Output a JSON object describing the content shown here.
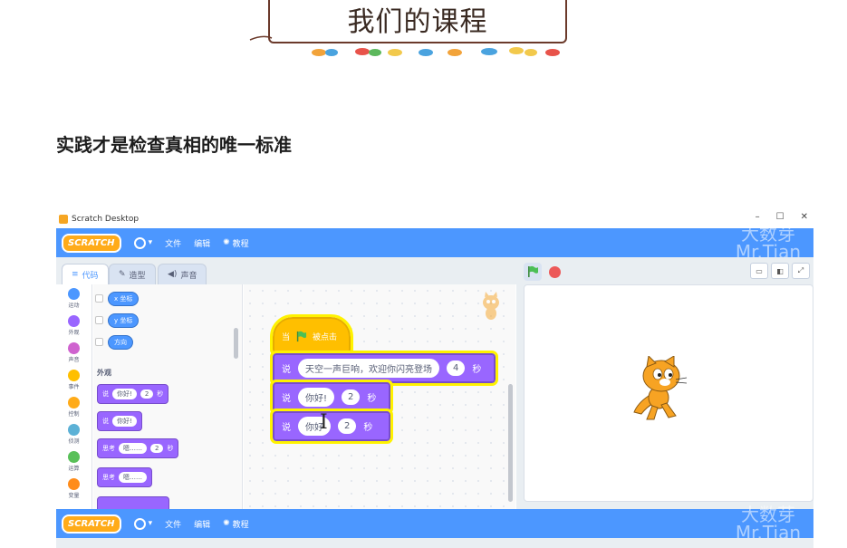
{
  "banner": {
    "title": "我们的课程"
  },
  "section": {
    "heading": "实践才是检查真相的唯一标准"
  },
  "window": {
    "title": "Scratch Desktop",
    "controls": [
      "–",
      "☐",
      "✕"
    ]
  },
  "menubar": {
    "logo": "SCRATCH",
    "file": "文件",
    "edit": "编辑",
    "tutorials": "教程",
    "watermark_line1": "大数芽",
    "watermark_line2": "Mr.Tian"
  },
  "tabs": {
    "code": "代码",
    "costumes": "造型",
    "sounds": "声音"
  },
  "categories": [
    {
      "label": "运动",
      "color": "#4c97ff"
    },
    {
      "label": "外观",
      "color": "#9966ff"
    },
    {
      "label": "声音",
      "color": "#cf63cf"
    },
    {
      "label": "事件",
      "color": "#ffbf00"
    },
    {
      "label": "控制",
      "color": "#ffab19"
    },
    {
      "label": "侦测",
      "color": "#5cb1d6"
    },
    {
      "label": "运算",
      "color": "#59c059"
    },
    {
      "label": "变量",
      "color": "#ff8c1a"
    }
  ],
  "palette": {
    "reporters": [
      "x 坐标",
      "y 坐标",
      "方向"
    ],
    "looks_heading": "外观",
    "blocks": [
      {
        "verb": "说",
        "input": "你好!",
        "num": "2",
        "unit": "秒"
      },
      {
        "verb": "说",
        "input": "你好!",
        "num": "",
        "unit": ""
      },
      {
        "verb": "思考",
        "input": "嗯……",
        "num": "2",
        "unit": "秒"
      },
      {
        "verb": "思考",
        "input": "嗯……",
        "num": "",
        "unit": ""
      }
    ]
  },
  "script": {
    "hat_when": "当",
    "hat_clicked": "被点击",
    "say_blocks": [
      {
        "verb": "说",
        "text": "天空一声巨响，欢迎你闪亮登场",
        "num": "4",
        "unit": "秒"
      },
      {
        "verb": "说",
        "text": "你好!",
        "num": "2",
        "unit": "秒"
      },
      {
        "verb": "说",
        "text": "你好",
        "num": "2",
        "unit": "秒"
      }
    ]
  },
  "colors": {
    "accent": "#4c97ff",
    "looks": "#9966ff",
    "events": "#ffbf00",
    "highlight": "#fff200"
  }
}
